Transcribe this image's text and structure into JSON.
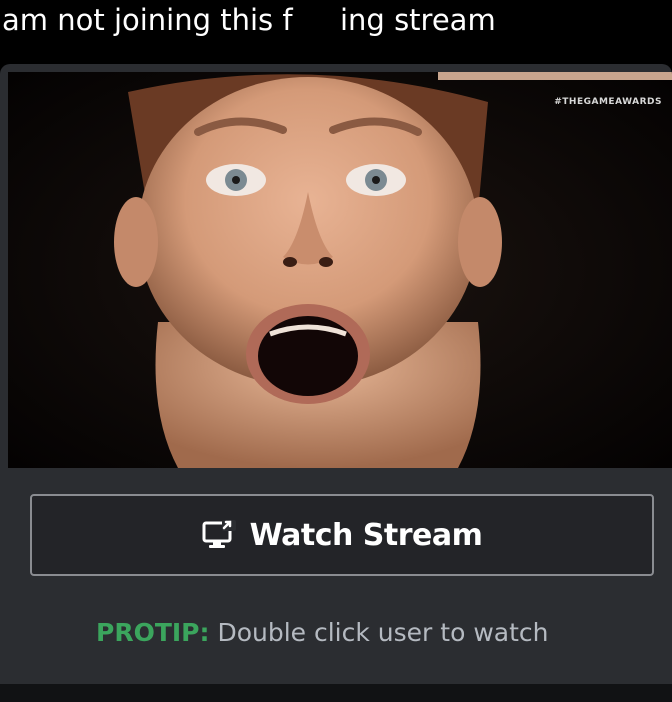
{
  "caption": {
    "part1": "am not joining this f",
    "part2": "ing stream"
  },
  "stream": {
    "watermark": "#THEGAMEAWARDS",
    "accent": "#2b2d31"
  },
  "watch_button": {
    "label": "Watch Stream",
    "icon": "screen-share-icon"
  },
  "protip": {
    "label": "PROTIP:",
    "text": " Double click user to watch",
    "label_color": "#3ba55d"
  }
}
